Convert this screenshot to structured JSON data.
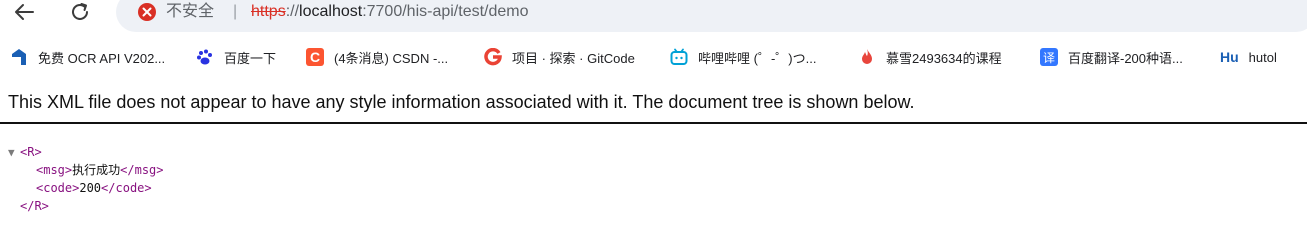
{
  "security": {
    "label": "不安全",
    "separator": "|"
  },
  "url": {
    "scheme": "https",
    "rest_prefix": "://",
    "host": "localhost",
    "path": ":7700/his-api/test/demo"
  },
  "bookmarks": [
    {
      "label": "免费 OCR API V202...",
      "icon": "ocr-logo-icon",
      "color": "#1a73e8"
    },
    {
      "label": "百度一下",
      "icon": "baidu-paw-icon",
      "color": "#2932e1"
    },
    {
      "label": "(4条消息) CSDN -...",
      "icon": "csdn-logo-icon",
      "color": "#fc5531"
    },
    {
      "label": "项目 · 探索 · GitCode",
      "icon": "gitcode-logo-icon",
      "color": "#ea4335"
    },
    {
      "label": "哔哩哔哩 (゜-゜)つ...",
      "icon": "bilibili-logo-icon",
      "color": "#00a1d6"
    },
    {
      "label": "慕雪2493634的课程",
      "icon": "flame-icon",
      "color": "#e8453c"
    },
    {
      "label": "百度翻译-200种语...",
      "icon": "baidu-translate-icon",
      "color": "#3377ff",
      "glyph": "译"
    },
    {
      "label": "hutol",
      "icon": "hutool-logo-icon",
      "color": "#1a5fb4",
      "glyph": "Hu"
    }
  ],
  "notice": "This XML file does not appear to have any style information associated with it. The document tree is shown below.",
  "xml": {
    "root_open": "<R>",
    "msg_open": "<msg>",
    "msg_value": "执行成功",
    "msg_close": "</msg>",
    "code_open": "<code>",
    "code_value": "200",
    "code_close": "</code>",
    "root_close": "</R>"
  }
}
